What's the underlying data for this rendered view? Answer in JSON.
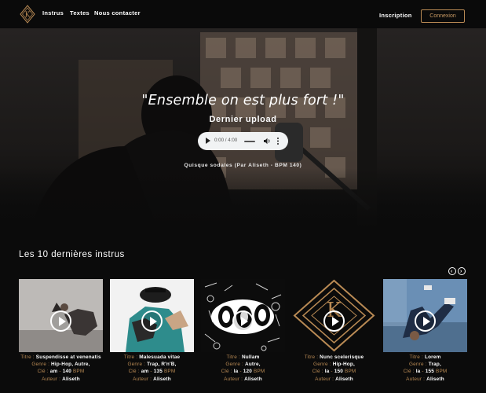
{
  "nav": {
    "links": [
      "Instrus",
      "Textes",
      "Nous contacter"
    ],
    "signup": "Inscription",
    "login": "Connexion"
  },
  "colors": {
    "accent": "#b98a54",
    "background": "#0b0b0b"
  },
  "hero": {
    "quote": "\"Ensemble on est plus fort !\"",
    "subtitle": "Dernier upload",
    "player": {
      "time": "0:00 / 4:00"
    },
    "upload_info": "Quisque sodales (Par Aliseth - BPM 140)"
  },
  "section": {
    "title": "Les 10 dernières instrus"
  },
  "cards": [
    {
      "titre": "Suspendisse at venenatis",
      "genre": "Hip-Hop, Autre,",
      "cle": "am",
      "bpm": "140",
      "auteur": "Aliseth"
    },
    {
      "titre": "Malesuada vitae",
      "genre": "Trap, R'n'B,",
      "cle": "am",
      "bpm": "135",
      "auteur": "Aliseth"
    },
    {
      "titre": "Nullam",
      "genre": "Autre,",
      "cle": "la",
      "bpm": "120",
      "auteur": "Aliseth"
    },
    {
      "titre": "Nunc scelerisque",
      "genre": "Hip-Hop,",
      "cle": "la",
      "bpm": "150",
      "auteur": "Aliseth"
    },
    {
      "titre": "Lorem",
      "genre": "Trap,",
      "cle": "la",
      "bpm": "155",
      "auteur": "Aliseth"
    }
  ],
  "labels": {
    "titre": "Titre",
    "genre": "Genre",
    "cle": "Clé",
    "auteur": "Auteur",
    "bpm_unit": "BPM"
  }
}
